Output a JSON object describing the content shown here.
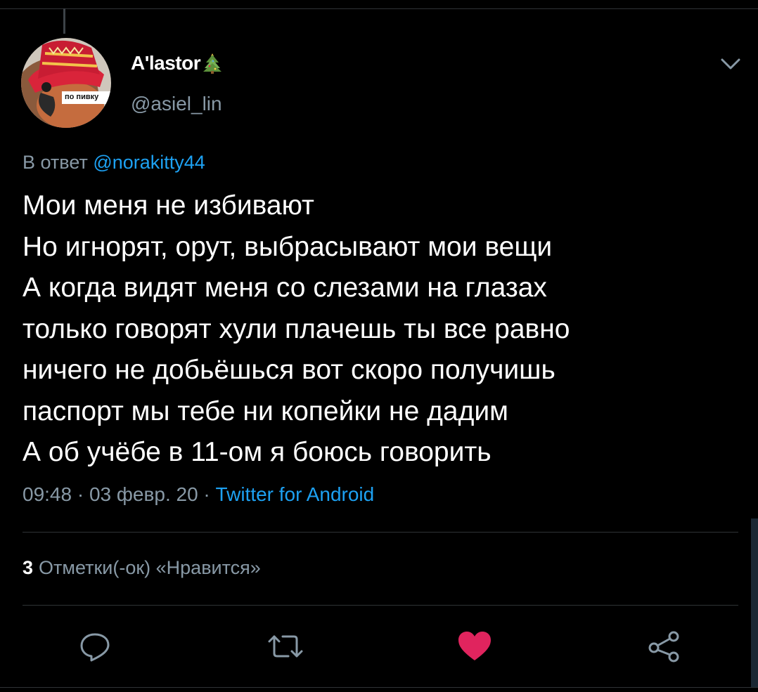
{
  "tweet": {
    "author": {
      "display_name": "A'lastor",
      "name_emoji": "christmas-tree-icon",
      "handle": "@asiel_lin",
      "avatar": {
        "caption": "по пивку",
        "icon": "avatar-parrot-in-hat"
      }
    },
    "reply": {
      "prefix": "В ответ",
      "mention": "@norakitty44"
    },
    "text_lines": [
      "Мои меня не избивают",
      "Но игнорят, орут, выбрасывают мои вещи",
      "А когда видят меня со слезами на глазах",
      "только говорят хули плачешь ты все равно",
      "ничего не добьёшься вот скоро получишь",
      "паспорт мы тебе ни копейки не дадим",
      "А об учёбе в 11-ом я боюсь говорить"
    ],
    "meta": {
      "time": "09:48",
      "separator": " · ",
      "date": "03 февр. 20",
      "source": "Twitter for Android"
    },
    "likes": {
      "count": "3",
      "label": "Отметки(-ок) «Нравится»"
    },
    "actions": {
      "reply_icon": "reply-icon",
      "retweet_icon": "retweet-icon",
      "like_icon": "heart-icon",
      "like_active": true,
      "share_icon": "share-icon"
    },
    "menu_icon": "chevron-down-icon"
  },
  "colors": {
    "background": "#000000",
    "text": "#ffffff",
    "muted": "#8899a6",
    "link": "#1da1f2",
    "like": "#e0245e",
    "divider": "#2f3336"
  }
}
